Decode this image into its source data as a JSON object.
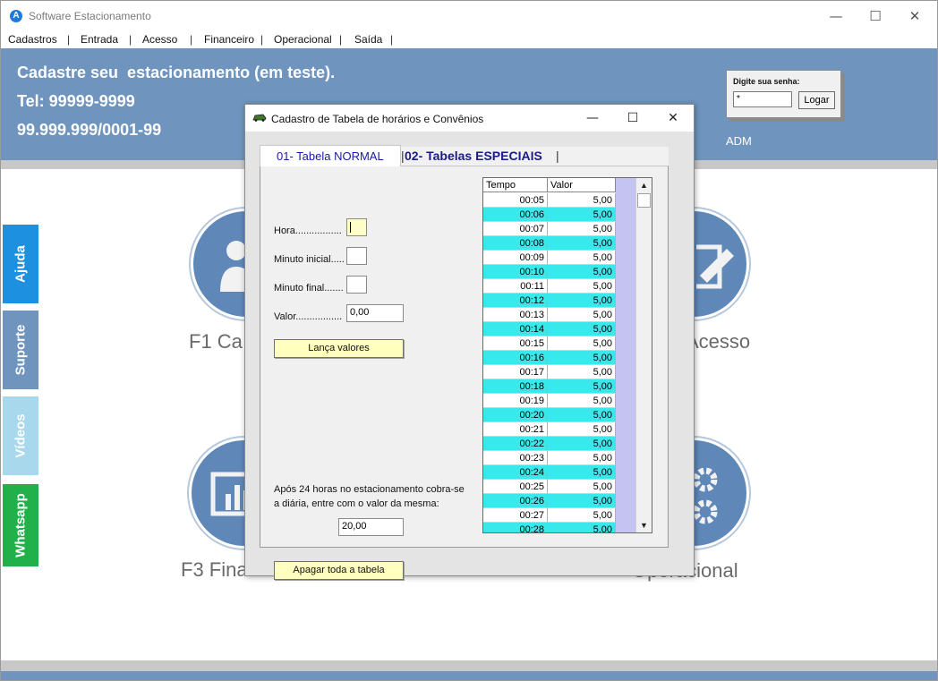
{
  "window": {
    "title": "Software Estacionamento",
    "controls": {
      "minimize": "—",
      "maximize": "☐",
      "close": "✕"
    }
  },
  "menu": [
    "Cadastros",
    "Entrada",
    "Acesso",
    "Financeiro",
    "Operacional",
    "Saída"
  ],
  "header": {
    "line1": "Cadastre seu  estacionamento (em teste).",
    "line2": "Tel: 99999-9999",
    "line3": "99.999.999/0001-99",
    "user": "ADM"
  },
  "login": {
    "label": "Digite sua senha:",
    "password_value": "*",
    "button": "Logar"
  },
  "side_tabs": [
    {
      "label": "Ajuda",
      "color": "#1e90e0"
    },
    {
      "label": "Suporte",
      "color": "#6f95be"
    },
    {
      "label": "Vídeos",
      "color": "#a8d8ec"
    },
    {
      "label": "Whatsapp",
      "color": "#22b04a"
    }
  ],
  "tiles": {
    "f1": "F1 Ca",
    "acesso": "Acesso",
    "f3": "F3 Fina",
    "operacional": "Operacional"
  },
  "dialog": {
    "title": "Cadastro de Tabela de horários e  Convênios",
    "controls": {
      "minimize": "—",
      "maximize": "☐",
      "close": "✕"
    },
    "tabs": [
      "01- Tabela NORMAL",
      "02- Tabelas ESPECIAIS"
    ],
    "form": {
      "hora_label": "Hora.................",
      "minuto_inicial_label": "Minuto inicial.....",
      "minuto_final_label": "Minuto final.......",
      "valor_label": "Valor.................",
      "valor_value": "0,00",
      "lanca_button": "Lança valores",
      "note": "Após 24 horas no estacionamento cobra-se a diária, entre com o valor da mesma:",
      "diaria_value": "20,00",
      "apagar_button": "Apagar toda a tabela"
    },
    "grid": {
      "columns": [
        "Tempo",
        "Valor"
      ],
      "rows": [
        [
          "00:05",
          "5,00"
        ],
        [
          "00:06",
          "5,00"
        ],
        [
          "00:07",
          "5,00"
        ],
        [
          "00:08",
          "5,00"
        ],
        [
          "00:09",
          "5,00"
        ],
        [
          "00:10",
          "5,00"
        ],
        [
          "00:11",
          "5,00"
        ],
        [
          "00:12",
          "5,00"
        ],
        [
          "00:13",
          "5,00"
        ],
        [
          "00:14",
          "5,00"
        ],
        [
          "00:15",
          "5,00"
        ],
        [
          "00:16",
          "5,00"
        ],
        [
          "00:17",
          "5,00"
        ],
        [
          "00:18",
          "5,00"
        ],
        [
          "00:19",
          "5,00"
        ],
        [
          "00:20",
          "5,00"
        ],
        [
          "00:21",
          "5,00"
        ],
        [
          "00:22",
          "5,00"
        ],
        [
          "00:23",
          "5,00"
        ],
        [
          "00:24",
          "5,00"
        ],
        [
          "00:25",
          "5,00"
        ],
        [
          "00:26",
          "5,00"
        ],
        [
          "00:27",
          "5,00"
        ],
        [
          "00:28",
          "5,00"
        ]
      ]
    }
  }
}
